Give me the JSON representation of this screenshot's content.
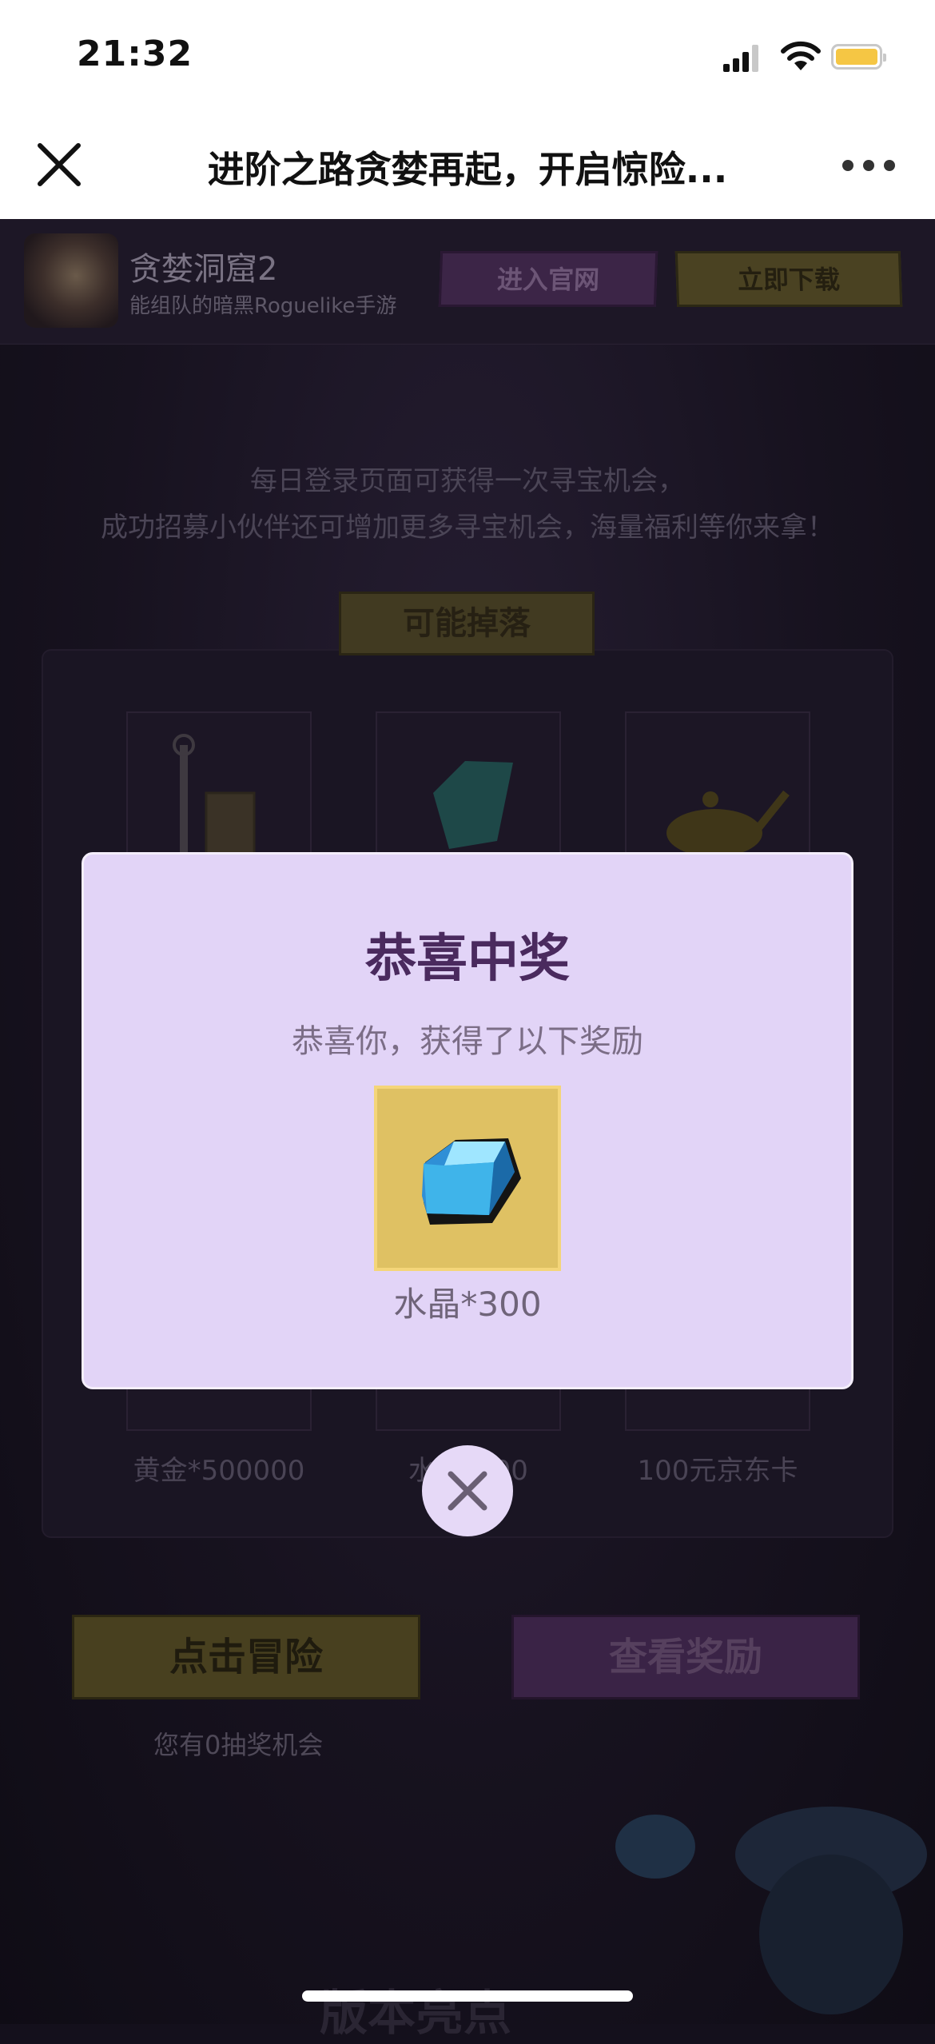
{
  "status_bar": {
    "time": "21:32"
  },
  "nav": {
    "title": "进阶之路贪婪再起，开启惊险...",
    "close_icon": "close-icon",
    "more_icon": "more-dots-icon"
  },
  "game_bar": {
    "name": "贪婪洞窟2",
    "subtitle": "能组队的暗黑Roguelike手游",
    "site_button": "进入官网",
    "download_button": "立即下载"
  },
  "page": {
    "desc_line1": "每日登录页面可获得一次寻宝机会，",
    "desc_line2": "成功招募小伙伴还可增加更多寻宝机会，海量福利等你来拿！",
    "drop_tag": "可能掉落",
    "drops": [
      {
        "label": "黄金*500000"
      },
      {
        "label": "水晶*300"
      },
      {
        "label": "100元京东卡"
      }
    ],
    "adventure_button": "点击冒险",
    "view_reward_button": "查看奖励",
    "chances_text": "您有0抽奖机会",
    "bottom_heading": "版本亮点"
  },
  "modal": {
    "title": "恭喜中奖",
    "message": "恭喜你，获得了以下奖励",
    "prize_label": "水晶*300",
    "prize_icon": "crystal-icon",
    "close_icon": "close-icon"
  },
  "colors": {
    "modal_bg": "#e2d4f7",
    "modal_title": "#4a2a5e",
    "prize_bg": "#dfc163",
    "battery": "#f5c644"
  }
}
